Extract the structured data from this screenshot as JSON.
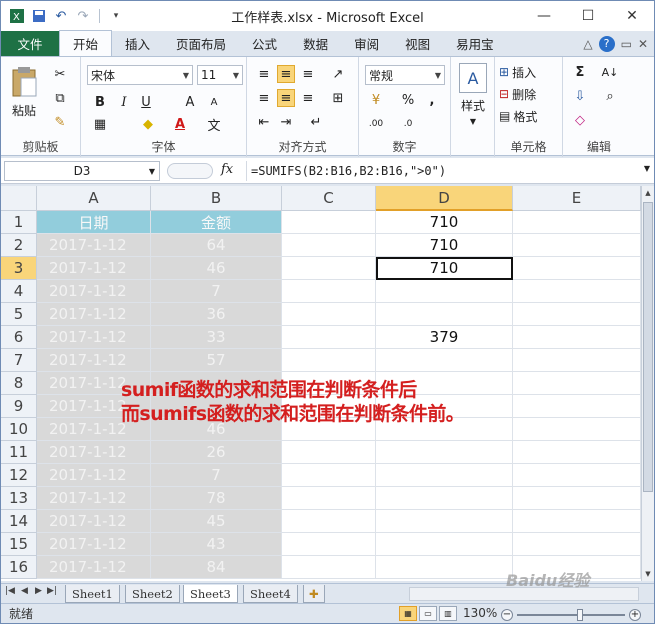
{
  "window": {
    "title": "工作样表.xlsx - Microsoft Excel",
    "controls": [
      "—",
      "☐",
      "✕"
    ]
  },
  "ribbon_tabs": [
    "文件",
    "开始",
    "插入",
    "页面布局",
    "公式",
    "数据",
    "审阅",
    "视图",
    "易用宝"
  ],
  "ribbon": {
    "clipboard": {
      "paste": "粘贴",
      "label": "剪贴板"
    },
    "font": {
      "name": "宋体",
      "size": "11",
      "label": "字体",
      "bold": "B",
      "italic": "I",
      "underline": "U"
    },
    "alignment": {
      "label": "对齐方式"
    },
    "number": {
      "format": "常规",
      "percent": "%",
      "comma": ",",
      "label": "数字"
    },
    "styles": {
      "label": "样式"
    },
    "cells": {
      "insert": "插入",
      "delete": "删除",
      "format": "格式",
      "label": "单元格"
    },
    "editing": {
      "sum": "Σ",
      "label": "编辑"
    }
  },
  "formula_bar": {
    "name_box": "D3",
    "fx": "fx",
    "formula": "=SUMIFS(B2:B16,B2:B16,\">0\")"
  },
  "columns": [
    "A",
    "B",
    "C",
    "D",
    "E"
  ],
  "rows": [
    {
      "n": "1",
      "a": "日期",
      "b": "金额",
      "d": "710"
    },
    {
      "n": "2",
      "a": "2017-1-12",
      "b": "64",
      "d": "710"
    },
    {
      "n": "3",
      "a": "2017-1-12",
      "b": "46",
      "d": "710"
    },
    {
      "n": "4",
      "a": "2017-1-12",
      "b": "7",
      "d": ""
    },
    {
      "n": "5",
      "a": "2017-1-12",
      "b": "36",
      "d": ""
    },
    {
      "n": "6",
      "a": "2017-1-12",
      "b": "33",
      "d": "379"
    },
    {
      "n": "7",
      "a": "2017-1-12",
      "b": "57",
      "d": ""
    },
    {
      "n": "8",
      "a": "2017-1-12",
      "b": "",
      "d": ""
    },
    {
      "n": "9",
      "a": "2017-1-12",
      "b": "",
      "d": ""
    },
    {
      "n": "10",
      "a": "2017-1-12",
      "b": "46",
      "d": ""
    },
    {
      "n": "11",
      "a": "2017-1-12",
      "b": "26",
      "d": ""
    },
    {
      "n": "12",
      "a": "2017-1-12",
      "b": "7",
      "d": ""
    },
    {
      "n": "13",
      "a": "2017-1-12",
      "b": "78",
      "d": ""
    },
    {
      "n": "14",
      "a": "2017-1-12",
      "b": "45",
      "d": ""
    },
    {
      "n": "15",
      "a": "2017-1-12",
      "b": "43",
      "d": ""
    },
    {
      "n": "16",
      "a": "2017-1-12",
      "b": "84",
      "d": ""
    }
  ],
  "active_cell": "D3",
  "annotation": {
    "line1": "sumif函数的求和范围在判断条件后",
    "line2": "而sumifs函数的求和范围在判断条件前。"
  },
  "sheets": [
    "Sheet1",
    "Sheet2",
    "Sheet3",
    "Sheet4"
  ],
  "active_sheet": "Sheet3",
  "status": {
    "text": "就绪",
    "zoom": "130%"
  },
  "watermark": "Baidu经验",
  "colors": {
    "file_tab": "#1e7145",
    "header_fill": "#92cddc",
    "data_fill": "#d9d9d9",
    "annotation": "#d41f1f",
    "selection": "#f9d57a"
  }
}
